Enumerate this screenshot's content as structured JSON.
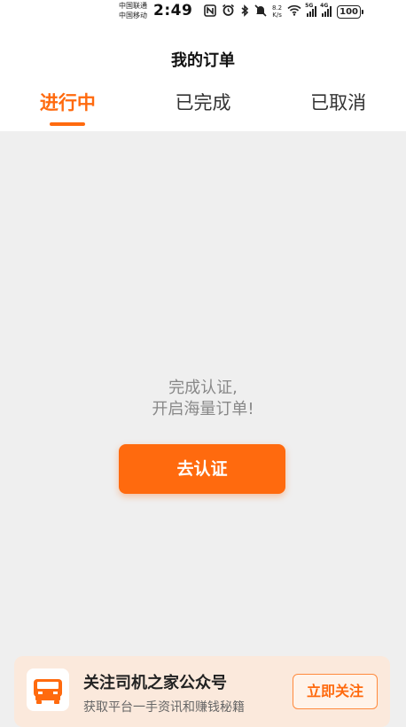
{
  "status_bar": {
    "carrier_1": "中国联通",
    "carrier_2": "中国移动",
    "time": "2:49",
    "net_speed_value": "8.2",
    "net_speed_unit": "K/s",
    "signal_1_tag": "5G",
    "signal_2_tag": "4G",
    "battery": "100"
  },
  "header": {
    "title": "我的订单"
  },
  "tabs": [
    {
      "label": "进行中",
      "active": true
    },
    {
      "label": "已完成",
      "active": false
    },
    {
      "label": "已取消",
      "active": false
    }
  ],
  "empty_state": {
    "line1": "完成认证,",
    "line2": "开启海量订单!",
    "button_label": "去认证"
  },
  "promo": {
    "title": "关注司机之家公众号",
    "subtitle": "获取平台一手资讯和赚钱秘籍",
    "button_label": "立即关注"
  },
  "colors": {
    "accent": "#ff6a0e",
    "background": "#efefef",
    "promo_background": "#fbe9dc"
  },
  "icons": [
    "nfc-icon",
    "alarm-icon",
    "bluetooth-icon",
    "mute-icon",
    "wifi-icon",
    "signal-icon",
    "battery-icon",
    "truck-logo-icon"
  ]
}
